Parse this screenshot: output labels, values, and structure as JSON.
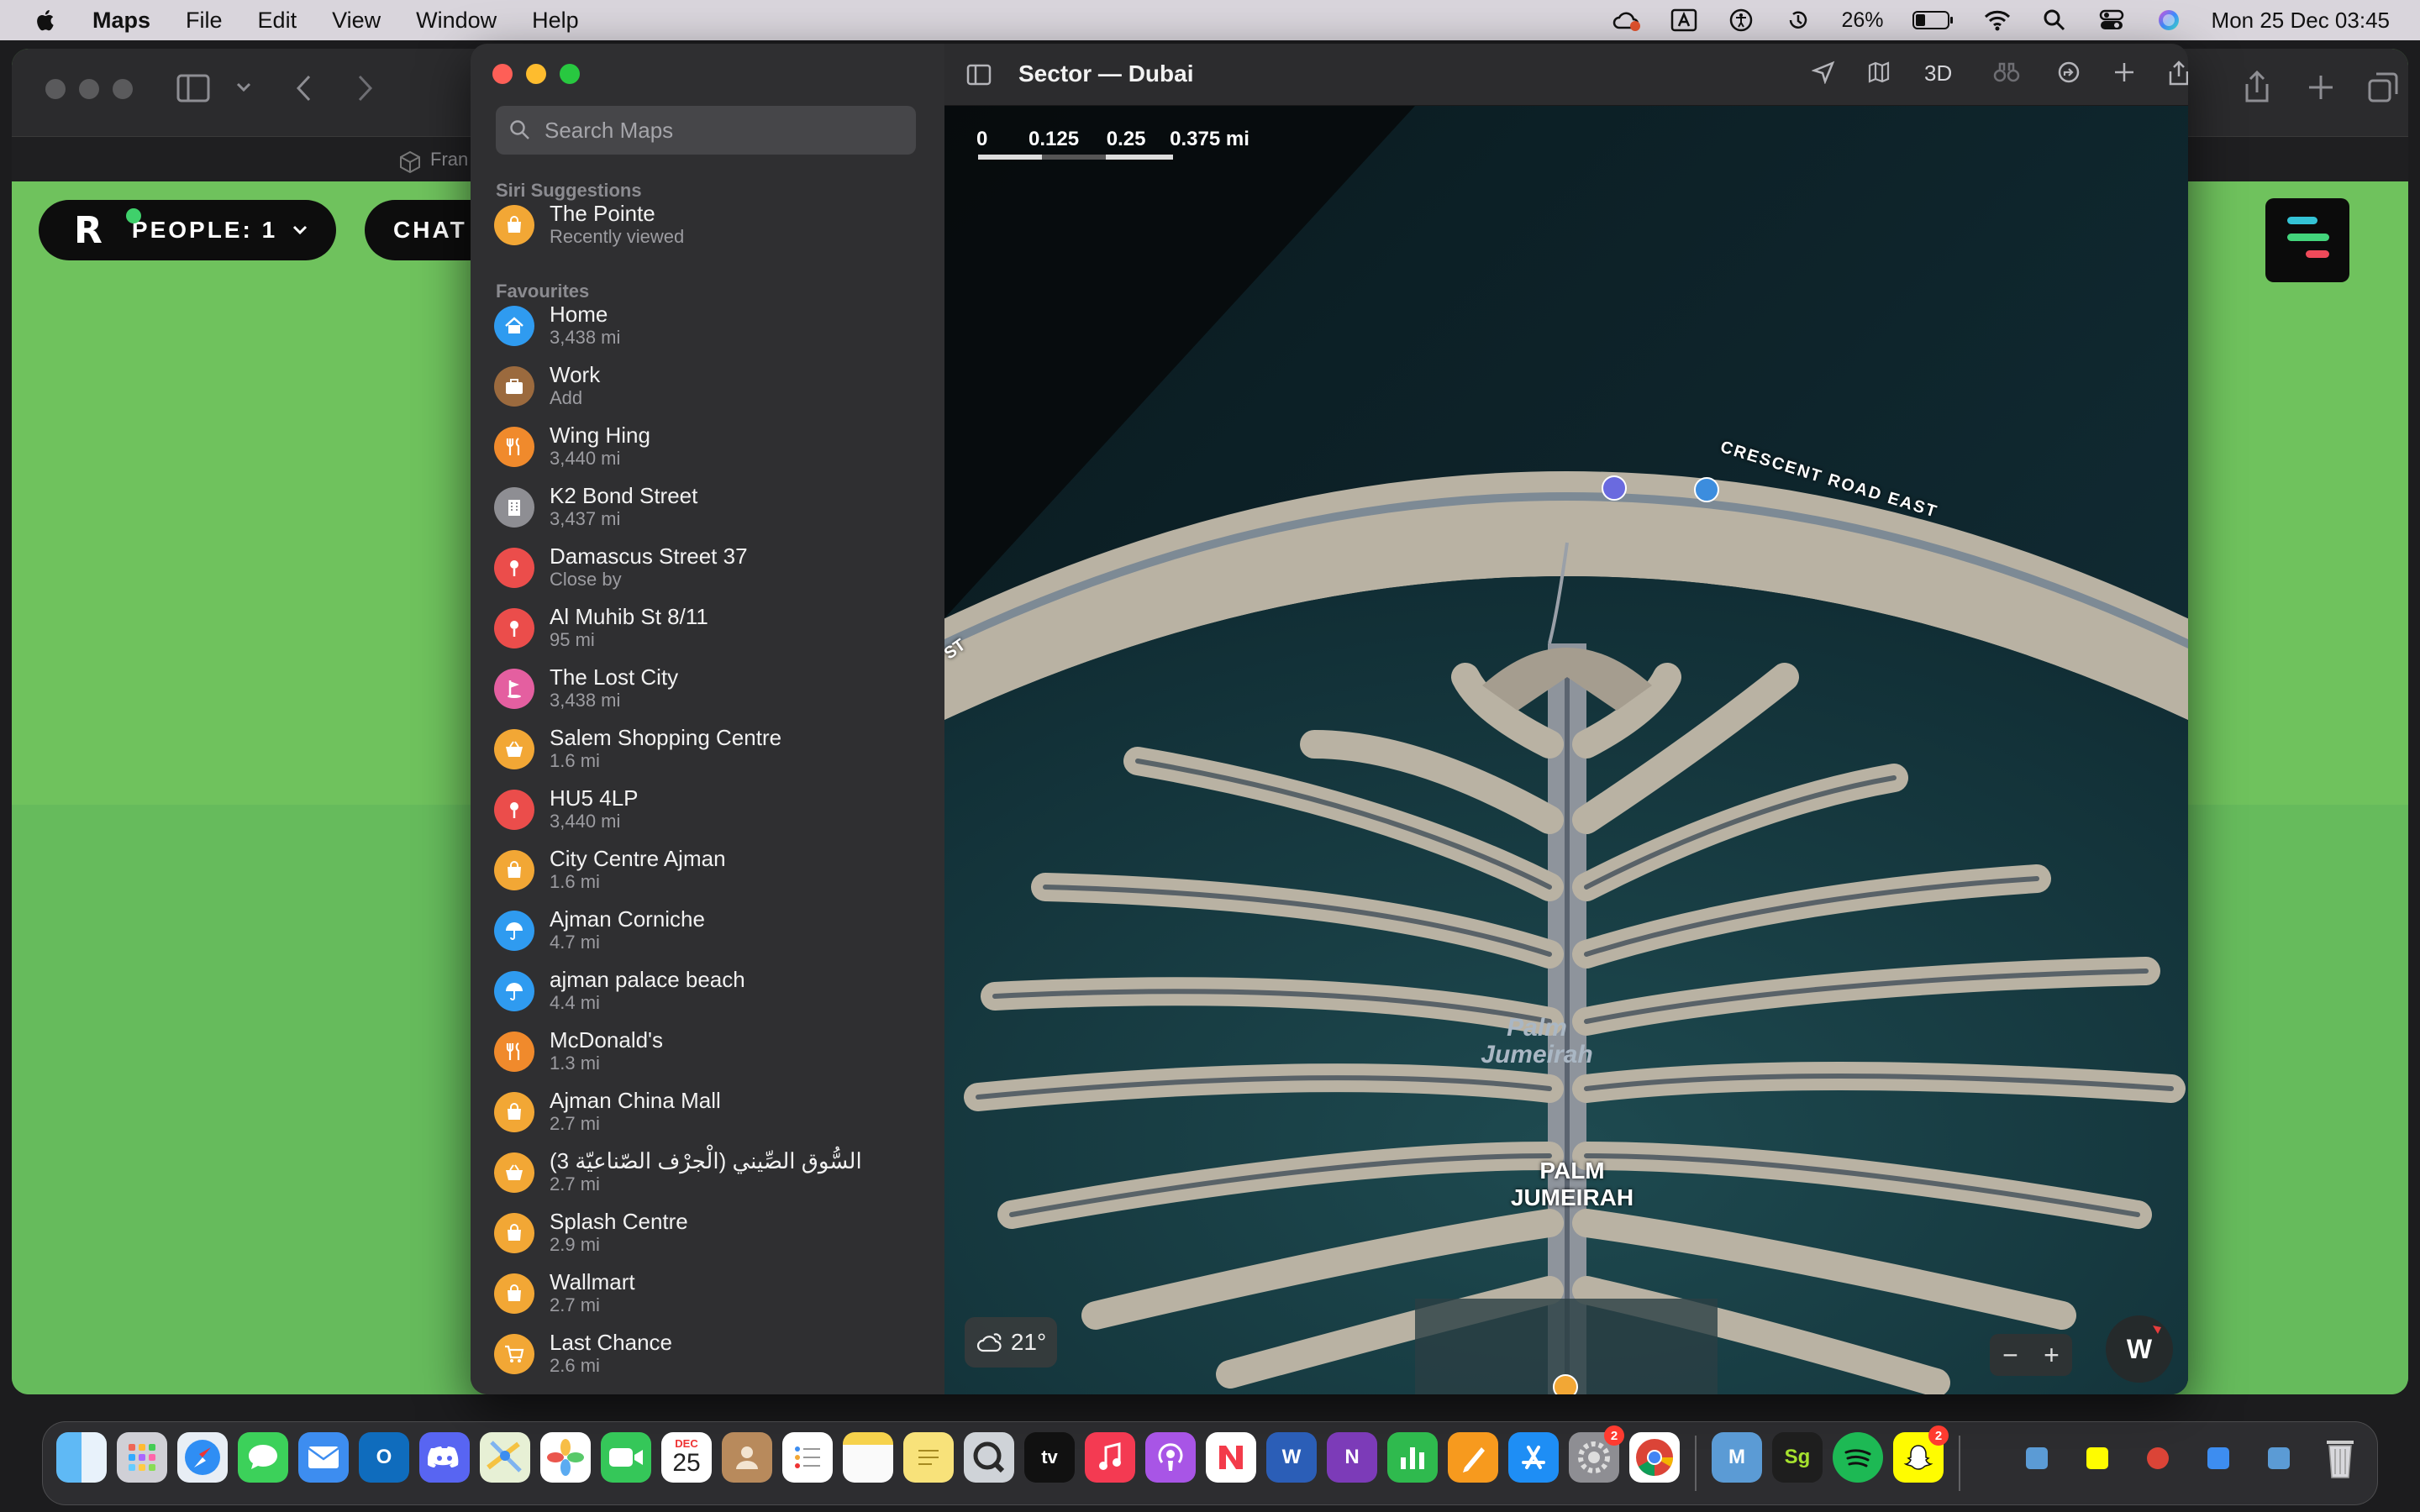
{
  "menubar": {
    "app_name": "Maps",
    "menus": [
      "File",
      "Edit",
      "View",
      "Window",
      "Help"
    ],
    "battery": "26%",
    "datetime": "Mon 25 Dec  03:45"
  },
  "background_app": {
    "tab_label": "Fran",
    "people_label": "PEOPLE: 1",
    "chat_label": "CHAT"
  },
  "maps": {
    "title": "Sector — Dubai",
    "view_3d_label": "3D",
    "search_placeholder": "Search Maps",
    "siri_heading": "Siri Suggestions",
    "favourites_heading": "Favourites",
    "items": [
      {
        "name": "The Pointe",
        "sub": "Recently viewed",
        "color": "#f2a735",
        "icon": "shopping-bag-icon"
      },
      {
        "name": "Home",
        "sub": "3,438 mi",
        "color": "#2f9bf0",
        "icon": "house-icon"
      },
      {
        "name": "Work",
        "sub": "Add",
        "color": "#9b6a3e",
        "icon": "briefcase-icon"
      },
      {
        "name": "Wing Hing",
        "sub": "3,440 mi",
        "color": "#f08a2c",
        "icon": "fork-knife-icon"
      },
      {
        "name": "K2 Bond Street",
        "sub": "3,437 mi",
        "color": "#8e8e93",
        "icon": "building-icon"
      },
      {
        "name": "Damascus Street 37",
        "sub": "Close by",
        "color": "#eb4d4b",
        "icon": "pin-icon"
      },
      {
        "name": "Al Muhib St 8/11",
        "sub": "95 mi",
        "color": "#eb4d4b",
        "icon": "pin-icon"
      },
      {
        "name": "The Lost City",
        "sub": "3,438 mi",
        "color": "#e45fa0",
        "icon": "golf-flag-icon"
      },
      {
        "name": "Salem Shopping Centre",
        "sub": "1.6 mi",
        "color": "#f2a735",
        "icon": "basket-icon"
      },
      {
        "name": "HU5 4LP",
        "sub": "3,440 mi",
        "color": "#eb4d4b",
        "icon": "pin-icon"
      },
      {
        "name": "City Centre Ajman",
        "sub": "1.6 mi",
        "color": "#f2a735",
        "icon": "shopping-bag-icon"
      },
      {
        "name": "Ajman Corniche",
        "sub": "4.7 mi",
        "color": "#2f9bf0",
        "icon": "umbrella-icon"
      },
      {
        "name": "ajman palace beach",
        "sub": "4.4 mi",
        "color": "#2f9bf0",
        "icon": "umbrella-icon"
      },
      {
        "name": "McDonald's",
        "sub": "1.3 mi",
        "color": "#f08a2c",
        "icon": "fork-knife-icon"
      },
      {
        "name": "Ajman China Mall",
        "sub": "2.7 mi",
        "color": "#f2a735",
        "icon": "shopping-bag-icon"
      },
      {
        "name": "السُّوق الصِّيني (الْجرْف الصّناعيّة 3)",
        "sub": "2.7 mi",
        "color": "#f2a735",
        "icon": "basket-icon"
      },
      {
        "name": "Splash Centre",
        "sub": "2.9 mi",
        "color": "#f2a735",
        "icon": "shopping-bag-icon"
      },
      {
        "name": "Wallmart",
        "sub": "2.7 mi",
        "color": "#f2a735",
        "icon": "shopping-bag-icon"
      },
      {
        "name": "Last Chance",
        "sub": "2.6 mi",
        "color": "#f2a735",
        "icon": "cart-icon"
      }
    ],
    "scale_labels": [
      "0",
      "0.125",
      "0.25",
      "0.375 mi"
    ],
    "weather": "21°",
    "compass": "W",
    "map_labels": {
      "road": "CRESCENT ROAD EAST",
      "road_fragment": "ST",
      "area_italic": "Palm Jumeirah",
      "area_caps": "PALM JUMEIRAH"
    }
  },
  "dock": {
    "calendar_month": "DEC",
    "calendar_day": "25",
    "tv_label": "tv",
    "badge_prefs": "2",
    "badge_snap": "2",
    "app_sg": "Sg"
  }
}
